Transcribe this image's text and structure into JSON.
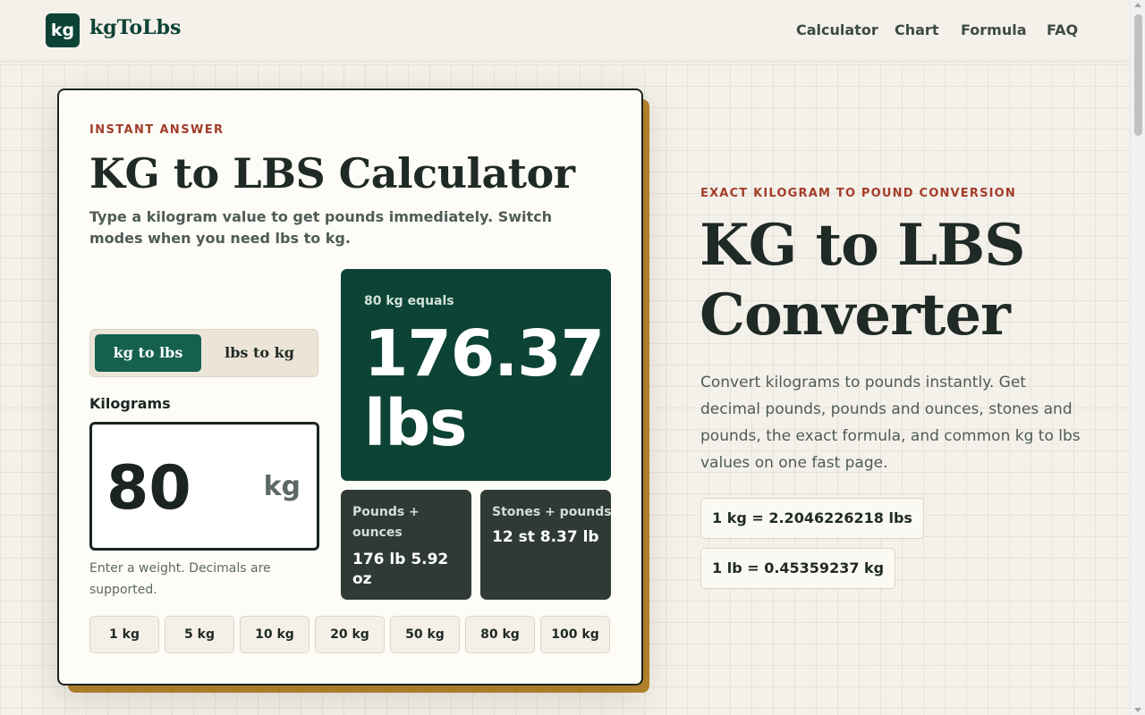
{
  "header": {
    "logo_badge": "kg",
    "logo_text": "kgToLbs",
    "nav": [
      "Calculator",
      "Chart",
      "Formula",
      "FAQ"
    ]
  },
  "card": {
    "eyebrow": "INSTANT ANSWER",
    "title": "KG to LBS Calculator",
    "subtitle": "Type a kilogram value to get pounds immediately. Switch modes when you need lbs to kg.",
    "modes": {
      "active": "kg to lbs",
      "inactive": "lbs to kg"
    },
    "field_label": "Kilograms",
    "input_value": "80",
    "input_unit": "kg",
    "helper": "Enter a weight. Decimals are supported.",
    "result": {
      "caption": "80 kg equals",
      "value": "176.37 lbs"
    },
    "pounds_ounces": {
      "title": "Pounds + ounces",
      "value": "176 lb 5.92 oz"
    },
    "stones_pounds": {
      "title": "Stones + pounds",
      "value": "12 st 8.37 lb"
    },
    "quick_values": [
      "1 kg",
      "5 kg",
      "10 kg",
      "20 kg",
      "50 kg",
      "80 kg",
      "100 kg"
    ]
  },
  "hero": {
    "eyebrow": "EXACT KILOGRAM TO POUND CONVERSION",
    "title": "KG to LBS Converter",
    "description": "Convert kilograms to pounds instantly. Get decimal pounds, pounds and ounces, stones and pounds, the exact formula, and common kg to lbs values on one fast page.",
    "facts": [
      "1 kg = 2.2046226218 lbs",
      "1 lb = 0.45359237 kg"
    ]
  },
  "colors": {
    "brand_green": "#0c4335",
    "accent_red": "#a33d2b",
    "shadow_gold": "#b8852d"
  }
}
